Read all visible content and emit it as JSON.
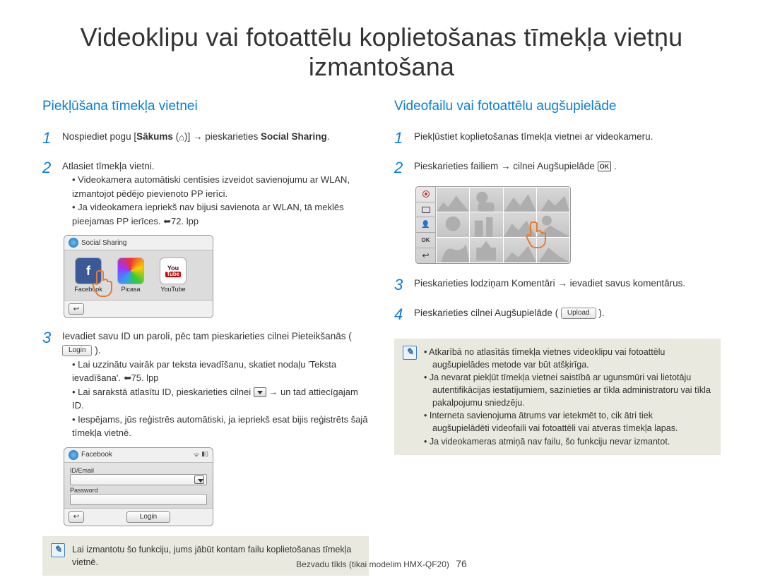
{
  "title": "Videoklipu vai fotoattēlu koplietošanas tīmekļa vietņu izmantošana",
  "left": {
    "heading": "Piekļūšana tīmekļa vietnei",
    "step1_pre": "Nospiediet pogu [",
    "step1_bold1": "Sākums",
    "step1_mid": " (",
    "step1_post": ")] → pieskarieties ",
    "step1_bold2": "Social Sharing",
    "step1_end": ".",
    "step2": "Atlasiet tīmekļa vietni.",
    "step2_b1": "Videokamera automātiski centīsies izveidot savienojumu ar WLAN, izmantojot pēdējo pievienoto PP ierīci.",
    "step2_b2_a": "Ja videokamera iepriekš nav bijusi savienota ar WLAN, tā meklēs pieejamas PP ierīces. ",
    "step2_b2_b": "72. lpp",
    "social_title": "Social Sharing",
    "app1": "Facebook",
    "app2": "Picasa",
    "app3": "YouTube",
    "step3_a": "Ievadiet savu ID un paroli, pēc tam pieskarieties cilnei Pieteikšanās ( ",
    "login_btn": "Login",
    "step3_b": " ).",
    "step3_bul1_a": "Lai uzzinātu vairāk par teksta ievadīšanu, skatiet nodaļu 'Teksta ievadīšana'. ",
    "step3_bul1_b": "75. lpp",
    "step3_bul2_a": "Lai sarakstā atlasītu ID, pieskarieties cilnei ",
    "step3_bul2_b": " → un tad attiecīgajam ID.",
    "step3_bul3": "Iespējams, jūs reģistrēs automātiski, ja iepriekš esat bijis reģistrēts šajā tīmekļa vietnē.",
    "fb_title": "Facebook",
    "id_label": "ID/Email",
    "pw_label": "Password",
    "login_label": "Login",
    "note": "Lai izmantotu šo funkciju, jums jābūt kontam failu koplietošanas tīmekļa vietnē."
  },
  "right": {
    "heading": "Videofailu vai fotoattēlu augšupielāde",
    "step1": "Piekļūstiet koplietošanas tīmekļa vietnei ar videokameru.",
    "step2_a": "Pieskarieties failiem → cilnei Augšupielāde ",
    "step2_ok": "OK",
    "step2_b": " .",
    "step3": "Pieskarieties lodziņam Komentāri → ievadiet savus komentārus.",
    "step4_a": "Pieskarieties cilnei Augšupielāde ( ",
    "upload_btn": "Upload",
    "step4_b": " ).",
    "note1": "Atkarībā no atlasītās tīmekļa vietnes videoklipu vai fotoattēlu augšupielādes metode var būt atšķirīga.",
    "note2": "Ja nevarat piekļūt tīmekļa vietnei saistībā ar ugunsmūri vai lietotāju autentifikācijas iestatījumiem, sazinieties ar tīkla administratoru vai tīkla pakalpojumu sniedzēju.",
    "note3": "Interneta savienojuma ātrums var ietekmēt to, cik ātri tiek augšupielādēti videofaili vai fotoattēli vai atveras tīmekļa lapas.",
    "note4": "Ja videokameras atmiņā nav failu, šo funkciju nevar izmantot."
  },
  "footer_text": "Bezvadu tīkls (tikai modelim HMX-QF20)",
  "page_number": "76"
}
